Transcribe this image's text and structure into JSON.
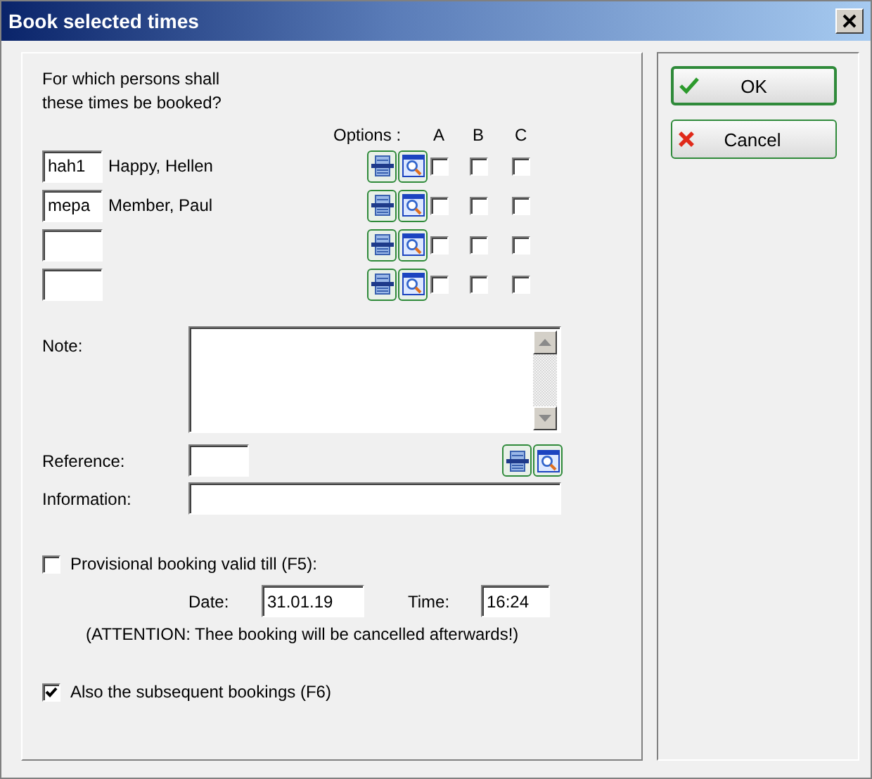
{
  "window": {
    "title": "Book selected times"
  },
  "persons": {
    "prompt": "For which persons shall these times be booked?",
    "options_label": "Options :",
    "columns": [
      "A",
      "B",
      "C"
    ],
    "rows": [
      {
        "code": "hah1",
        "name": "Happy, Hellen",
        "checks": [
          {
            "checked": false
          },
          {
            "checked": false
          },
          {
            "checked": false
          }
        ]
      },
      {
        "code": "mepa",
        "name": "Member, Paul",
        "checks": [
          {
            "checked": false
          },
          {
            "checked": false
          },
          {
            "checked": false
          }
        ]
      },
      {
        "checks": [
          {
            "checked": false
          },
          {
            "checked": false
          },
          {
            "checked": false
          }
        ]
      },
      {
        "checks": [
          {
            "checked": false
          },
          {
            "checked": false
          },
          {
            "checked": false
          }
        ]
      }
    ]
  },
  "note": {
    "label": "Note:"
  },
  "reference": {
    "label": "Reference:"
  },
  "information": {
    "label": "Information:"
  },
  "provisional": {
    "label": "Provisional booking valid till (F5):",
    "checked": false
  },
  "date": {
    "label": "Date:",
    "value": "31.01.19"
  },
  "time": {
    "label": "Time:",
    "value": "16:24"
  },
  "attention": "(ATTENTION: Thee booking will be cancelled afterwards!)",
  "subsequent": {
    "label": "Also the subsequent bookings (F6)",
    "checked": true
  },
  "buttons": [
    {
      "label": "OK",
      "kind": "ok"
    },
    {
      "label": "Cancel",
      "kind": "cancel"
    }
  ]
}
